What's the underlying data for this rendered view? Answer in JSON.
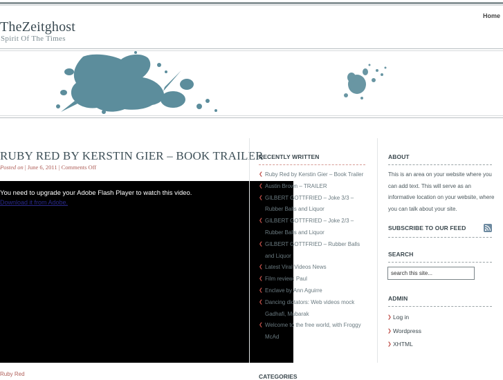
{
  "site": {
    "title": "TheZeitghost",
    "tagline": "Spirit Of The Times"
  },
  "nav": {
    "home": "Home"
  },
  "post": {
    "title": "RUBY RED BY KERSTIN GIER – BOOK TRAILER",
    "meta_prefix": "Posted on ",
    "meta_date": "June 6, 2011",
    "meta_comments": "Comments Off",
    "flash_message": "You need to upgrade your Adobe Flash Player to watch this video.",
    "flash_link": "Download it from Adobe.",
    "bottom_text": "Ruby Red"
  },
  "recently_written": {
    "title": "RECENTLY WRITTEN",
    "items": [
      "Ruby Red by Kerstin Gier – Book Trailer",
      "Austin Brown – TRAILER",
      "GILBERT GOTTFRIED – Joke 3/3 – Rubber Balls and Liquor",
      "GILBERT GOTTFRIED – Joke 2/3 – Rubber Balls and Liquor",
      "GILBERT GOTTFRIED – Rubber Balls and Liquor",
      "Latest Viral Videos News",
      "Film review: Paul",
      "Enclave by Ann Aguirre",
      "Dancing dictators: Web videos mock Gadhafi, Mubarak",
      "Welcome to the free world, with Froggy McAd"
    ]
  },
  "categories": {
    "title": "CATEGORIES"
  },
  "about": {
    "title": "ABOUT",
    "text": "This is an area on your website where you can add text. This will serve as an informative location on your website, where you can talk about your site."
  },
  "subscribe": {
    "title": "SUBSCRIBE TO OUR FEED",
    "icon": "rss-icon"
  },
  "search": {
    "title": "SEARCH",
    "value": "search this site..."
  },
  "admin": {
    "title": "ADMIN",
    "items": [
      "Log in",
      "Wordpress",
      "XHTML"
    ]
  },
  "colors": {
    "accent_red": "#c0504a",
    "splash_blue": "#4f8494",
    "title_slate": "#3d4f57"
  }
}
